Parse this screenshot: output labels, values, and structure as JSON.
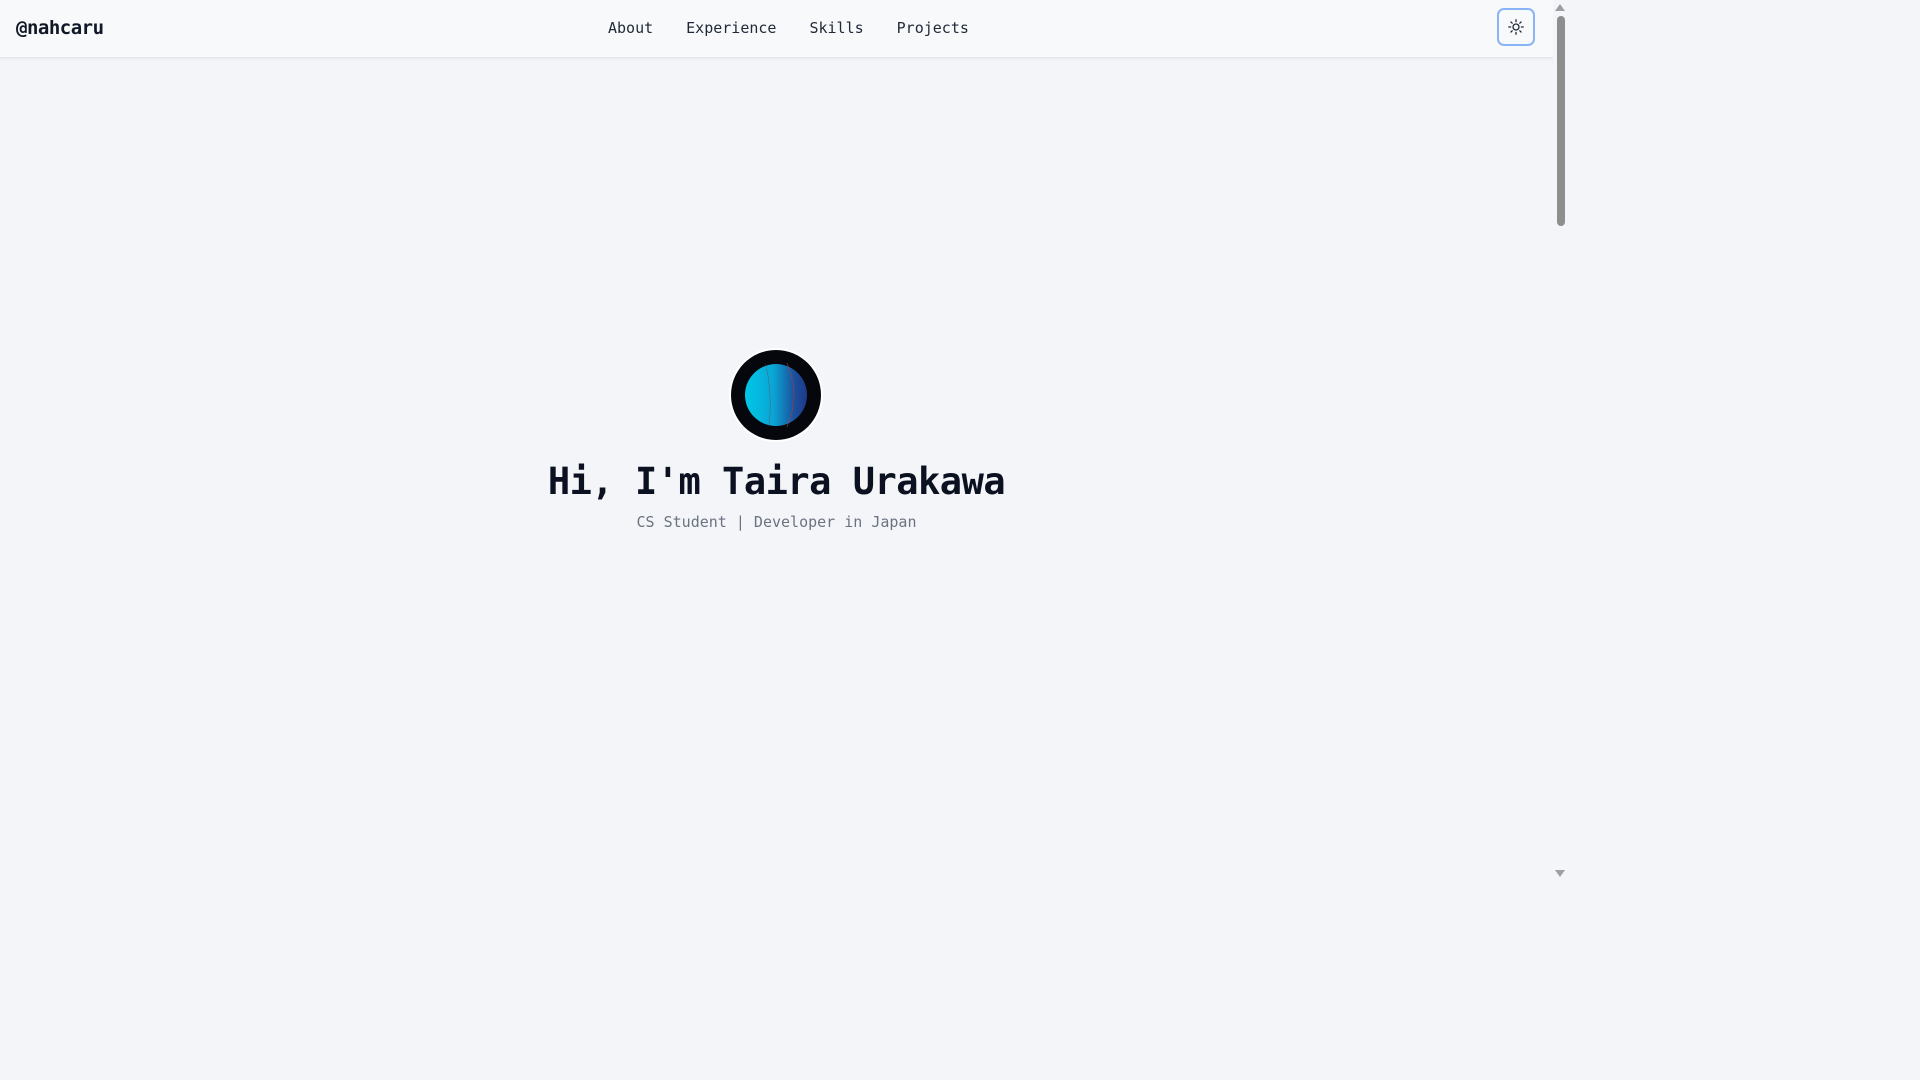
{
  "header": {
    "brand": "@nahcaru",
    "nav": [
      {
        "label": "About"
      },
      {
        "label": "Experience"
      },
      {
        "label": "Skills"
      },
      {
        "label": "Projects"
      }
    ],
    "theme_toggle_icon": "sun-icon"
  },
  "hero": {
    "title": "Hi, I'm Taira Urakawa",
    "subtitle": "CS Student | Developer in Japan",
    "avatar_icon": "planet-avatar"
  },
  "colors": {
    "page_bg": "#f3f5f9",
    "header_bg": "#f8f9fb",
    "text_primary": "#0b1120",
    "text_muted": "#6b7280",
    "focus_ring": "#8ab4f8",
    "avatar_bg": "#05070c",
    "planet_light": "#00c2e0",
    "planet_dark": "#1e3a8a"
  }
}
